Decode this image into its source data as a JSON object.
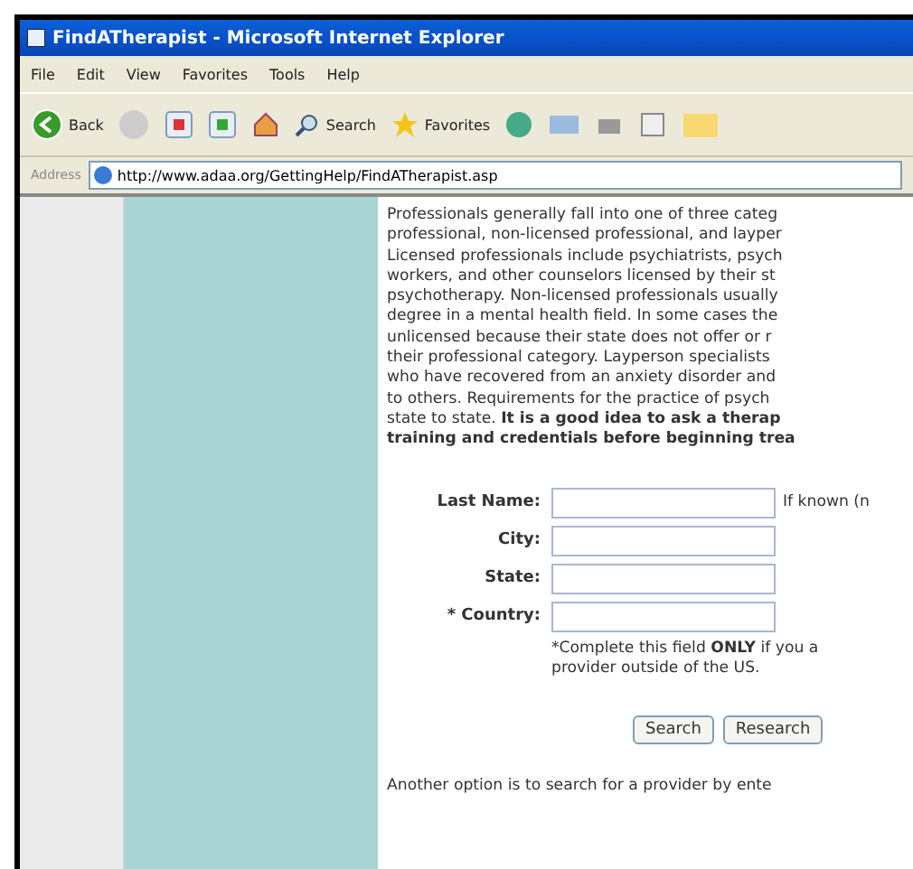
{
  "window": {
    "title": "FindATherapist - Microsoft Internet Explorer"
  },
  "menu": [
    "File",
    "Edit",
    "View",
    "Favorites",
    "Tools",
    "Help"
  ],
  "toolbar": {
    "back": "Back",
    "search": "Search",
    "favorites": "Favorites"
  },
  "address": {
    "label": "Address",
    "url": "http://www.adaa.org/GettingHelp/FindATherapist.asp"
  },
  "paragraph_lines": [
    "Professionals generally fall into one of three categ",
    "professional, non-licensed professional, and layper",
    "Licensed professionals include psychiatrists, psych",
    "workers, and other counselors licensed by their st",
    "psychotherapy. Non-licensed professionals usually",
    "degree in a mental health field. In some cases the",
    "unlicensed because their state does not offer or r",
    "their professional category. Layperson specialists",
    "who have recovered from an anxiety disorder and",
    "to others. Requirements for the practice of psych",
    "state to state. **It is a good idea to ask a therap**",
    "**training and credentials before beginning trea**"
  ],
  "form": {
    "fields": [
      {
        "label": "Last Name:",
        "hint": "If known (n"
      },
      {
        "label": "City:"
      },
      {
        "label": "State:"
      },
      {
        "label": "* Country:"
      }
    ],
    "note_lines": [
      "*Complete this field **ONLY** if you a",
      "provider outside of the US."
    ],
    "buttons": [
      "Search",
      "Research"
    ]
  },
  "footer_line": "Another option is to search for a provider by ente"
}
